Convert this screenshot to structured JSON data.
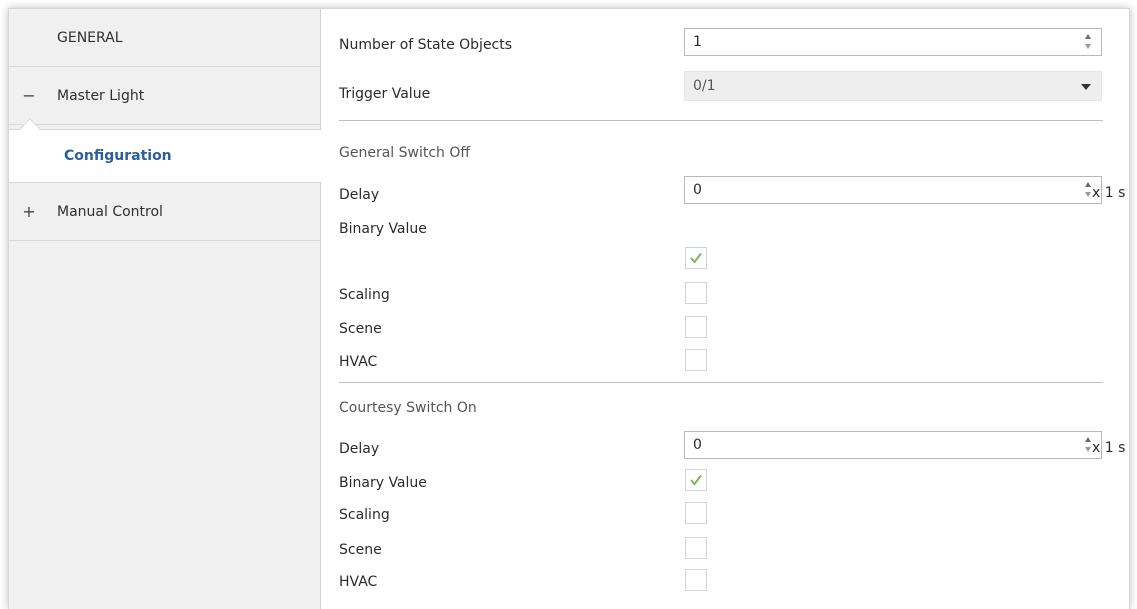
{
  "sidebar": {
    "items": [
      {
        "label": "GENERAL"
      },
      {
        "label": "Master Light",
        "toggle": "−"
      },
      {
        "label": "Configuration"
      },
      {
        "label": "Manual Control",
        "toggle": "+"
      }
    ]
  },
  "main": {
    "num_state_objects": {
      "label": "Number of State Objects",
      "value": "1"
    },
    "trigger_value": {
      "label": "Trigger Value",
      "value": "0/1"
    },
    "general_switch_off": {
      "title": "General Switch Off",
      "delay_label": "Delay",
      "delay_value": "0",
      "delay_unit": "x 1 s",
      "binary_label": "Binary Value",
      "binary_checked": true,
      "scaling_label": "Scaling",
      "scaling_checked": false,
      "scene_label": "Scene",
      "scene_checked": false,
      "hvac_label": "HVAC",
      "hvac_checked": false
    },
    "courtesy_switch_on": {
      "title": "Courtesy Switch On",
      "delay_label": "Delay",
      "delay_value": "0",
      "delay_unit": "x 1 s",
      "binary_label": "Binary Value",
      "binary_checked": true,
      "scaling_label": "Scaling",
      "scaling_checked": false,
      "scene_label": "Scene",
      "scene_checked": false,
      "hvac_label": "HVAC",
      "hvac_checked": false
    }
  },
  "colors": {
    "selected_text": "#2a5f9e",
    "check": "#7bb661",
    "sidebar_bg": "#f0f0f0"
  }
}
